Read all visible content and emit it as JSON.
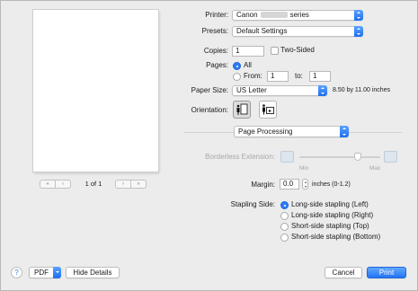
{
  "preview": {
    "page_indicator": "1 of 1"
  },
  "printer": {
    "label": "Printer:",
    "name_prefix": "Canon",
    "name_suffix": "series"
  },
  "presets": {
    "label": "Presets:",
    "value": "Default Settings"
  },
  "copies": {
    "label": "Copies:",
    "value": "1",
    "two_sided_label": "Two-Sided",
    "two_sided_checked": false
  },
  "pages": {
    "label": "Pages:",
    "all_label": "All",
    "from_label": "From:",
    "from_value": "1",
    "to_label": "to:",
    "to_value": "1",
    "selected": "All"
  },
  "paper_size": {
    "label": "Paper Size:",
    "value": "US Letter",
    "dimensions": "8.50 by 11.00 inches"
  },
  "orientation": {
    "label": "Orientation:",
    "selected": "portrait"
  },
  "section": {
    "value": "Page Processing"
  },
  "borderless": {
    "label": "Borderless Extension:",
    "min_label": "Min",
    "max_label": "Max",
    "level": 0.72,
    "enabled": false
  },
  "margin": {
    "label": "Margin:",
    "value": "0.0",
    "unit": "inches (0-1.2)"
  },
  "stapling": {
    "label": "Stapling Side:",
    "options": [
      {
        "label": "Long-side stapling (Left)",
        "selected": true
      },
      {
        "label": "Long-side stapling (Right)",
        "selected": false
      },
      {
        "label": "Short-side stapling (Top)",
        "selected": false
      },
      {
        "label": "Short-side stapling (Bottom)",
        "selected": false
      }
    ]
  },
  "footer": {
    "help": "?",
    "pdf_label": "PDF",
    "hide_details": "Hide Details",
    "cancel": "Cancel",
    "print": "Print"
  },
  "colors": {
    "accent": "#2f7cf6",
    "window_bg": "#ececec"
  }
}
